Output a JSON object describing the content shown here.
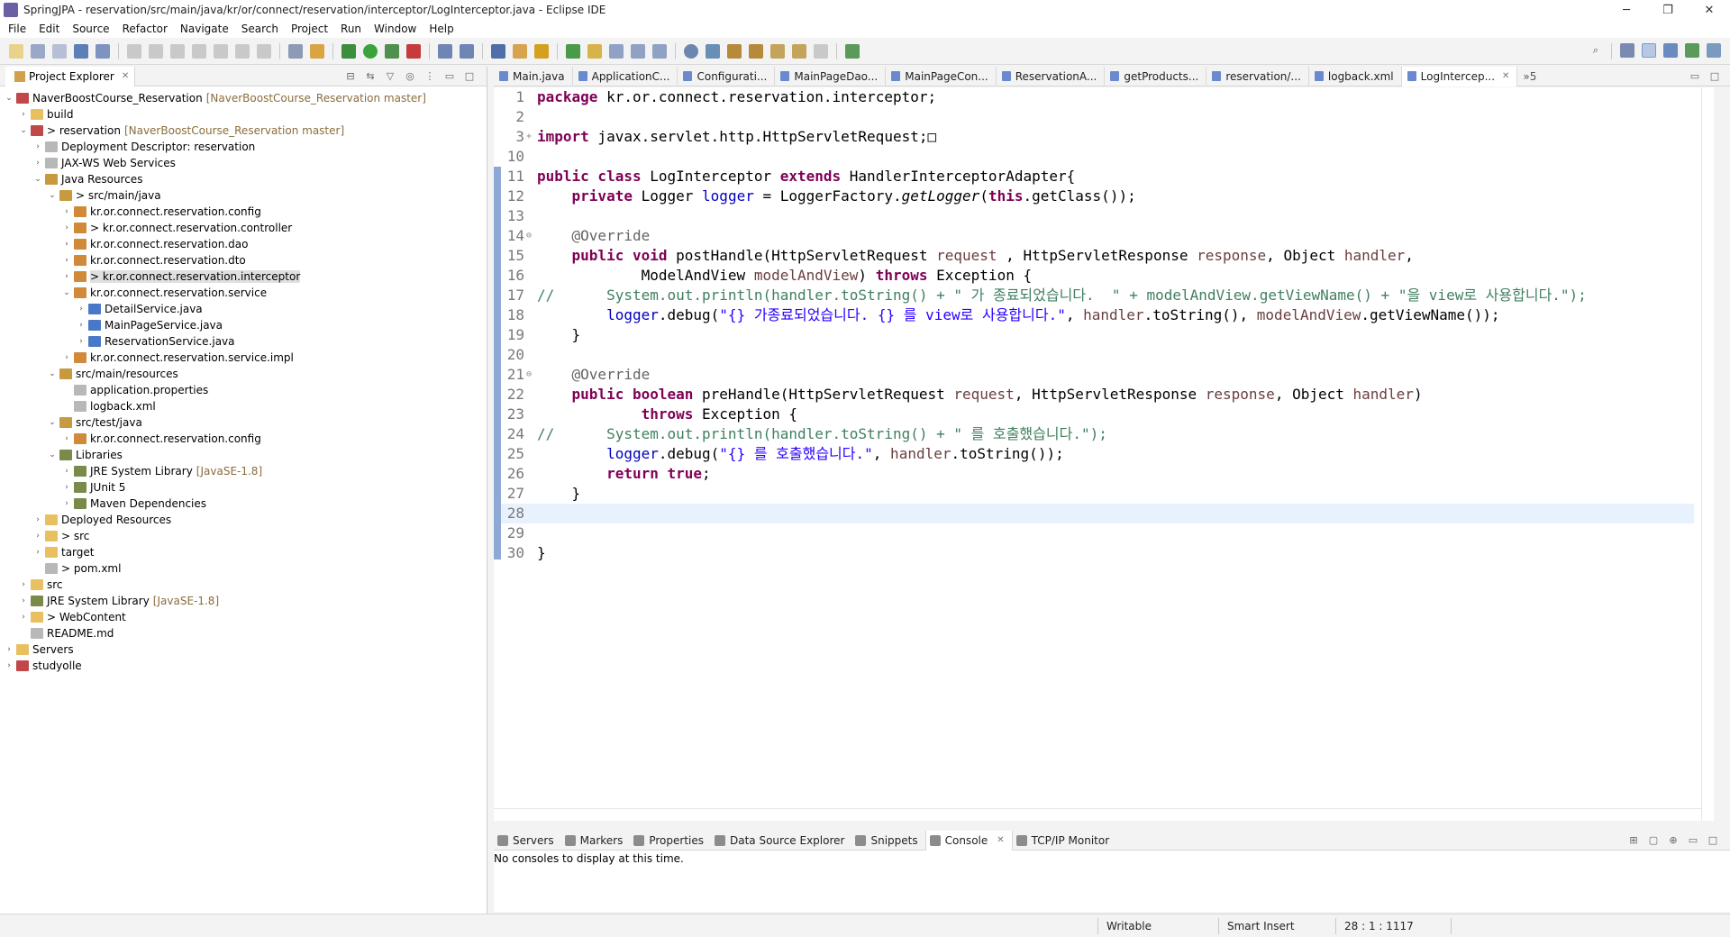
{
  "window": {
    "title": "SpringJPA - reservation/src/main/java/kr/or/connect/reservation/interceptor/LogInterceptor.java - Eclipse IDE",
    "minimize": "─",
    "maximize": "❐",
    "close": "✕"
  },
  "menu": [
    "File",
    "Edit",
    "Source",
    "Refactor",
    "Navigate",
    "Search",
    "Project",
    "Run",
    "Window",
    "Help"
  ],
  "explorer": {
    "title": "Project Explorer",
    "close": "✕",
    "tree": [
      {
        "label": "NaverBoostCourse_Reservation",
        "deco": "[NaverBoostCourse_Reservation master]",
        "indent": 0,
        "arrow": "v",
        "icon": "proj"
      },
      {
        "label": "build",
        "deco": "",
        "indent": 1,
        "arrow": ">",
        "icon": "folder"
      },
      {
        "label": "> reservation",
        "deco": "[NaverBoostCourse_Reservation master]",
        "indent": 1,
        "arrow": "v",
        "icon": "proj"
      },
      {
        "label": "Deployment Descriptor: reservation",
        "deco": "",
        "indent": 2,
        "arrow": ">",
        "icon": "file"
      },
      {
        "label": "JAX-WS Web Services",
        "deco": "",
        "indent": 2,
        "arrow": ">",
        "icon": "file"
      },
      {
        "label": "Java Resources",
        "deco": "",
        "indent": 2,
        "arrow": "v",
        "icon": "srcf"
      },
      {
        "label": "> src/main/java",
        "deco": "",
        "indent": 3,
        "arrow": "v",
        "icon": "srcf"
      },
      {
        "label": "kr.or.connect.reservation.config",
        "deco": "",
        "indent": 4,
        "arrow": ">",
        "icon": "pkg"
      },
      {
        "label": "> kr.or.connect.reservation.controller",
        "deco": "",
        "indent": 4,
        "arrow": ">",
        "icon": "pkg"
      },
      {
        "label": "kr.or.connect.reservation.dao",
        "deco": "",
        "indent": 4,
        "arrow": ">",
        "icon": "pkg"
      },
      {
        "label": "kr.or.connect.reservation.dto",
        "deco": "",
        "indent": 4,
        "arrow": ">",
        "icon": "pkg"
      },
      {
        "label": "> kr.or.connect.reservation.interceptor",
        "deco": "",
        "indent": 4,
        "arrow": ">",
        "icon": "pkg",
        "selected": true
      },
      {
        "label": "kr.or.connect.reservation.service",
        "deco": "",
        "indent": 4,
        "arrow": "v",
        "icon": "pkg"
      },
      {
        "label": "DetailService.java",
        "deco": "",
        "indent": 5,
        "arrow": ">",
        "icon": "java"
      },
      {
        "label": "MainPageService.java",
        "deco": "",
        "indent": 5,
        "arrow": ">",
        "icon": "java"
      },
      {
        "label": "ReservationService.java",
        "deco": "",
        "indent": 5,
        "arrow": ">",
        "icon": "java"
      },
      {
        "label": "kr.or.connect.reservation.service.impl",
        "deco": "",
        "indent": 4,
        "arrow": ">",
        "icon": "pkg"
      },
      {
        "label": "src/main/resources",
        "deco": "",
        "indent": 3,
        "arrow": "v",
        "icon": "srcf"
      },
      {
        "label": "application.properties",
        "deco": "",
        "indent": 4,
        "arrow": "",
        "icon": "file"
      },
      {
        "label": "logback.xml",
        "deco": "",
        "indent": 4,
        "arrow": "",
        "icon": "file"
      },
      {
        "label": "src/test/java",
        "deco": "",
        "indent": 3,
        "arrow": "v",
        "icon": "srcf"
      },
      {
        "label": "kr.or.connect.reservation.config",
        "deco": "",
        "indent": 4,
        "arrow": ">",
        "icon": "pkg"
      },
      {
        "label": "Libraries",
        "deco": "",
        "indent": 3,
        "arrow": "v",
        "icon": "lib"
      },
      {
        "label": "JRE System Library",
        "deco": "[JavaSE-1.8]",
        "indent": 4,
        "arrow": ">",
        "icon": "lib"
      },
      {
        "label": "JUnit 5",
        "deco": "",
        "indent": 4,
        "arrow": ">",
        "icon": "lib"
      },
      {
        "label": "Maven Dependencies",
        "deco": "",
        "indent": 4,
        "arrow": ">",
        "icon": "lib"
      },
      {
        "label": "Deployed Resources",
        "deco": "",
        "indent": 2,
        "arrow": ">",
        "icon": "folder"
      },
      {
        "label": "> src",
        "deco": "",
        "indent": 2,
        "arrow": ">",
        "icon": "folder"
      },
      {
        "label": "target",
        "deco": "",
        "indent": 2,
        "arrow": ">",
        "icon": "folder"
      },
      {
        "label": "> pom.xml",
        "deco": "",
        "indent": 2,
        "arrow": "",
        "icon": "file"
      },
      {
        "label": "src",
        "deco": "",
        "indent": 1,
        "arrow": ">",
        "icon": "folder"
      },
      {
        "label": "JRE System Library",
        "deco": "[JavaSE-1.8]",
        "indent": 1,
        "arrow": ">",
        "icon": "lib"
      },
      {
        "label": "> WebContent",
        "deco": "",
        "indent": 1,
        "arrow": ">",
        "icon": "folder"
      },
      {
        "label": "README.md",
        "deco": "",
        "indent": 1,
        "arrow": "",
        "icon": "file"
      },
      {
        "label": "Servers",
        "deco": "",
        "indent": 0,
        "arrow": ">",
        "icon": "folder"
      },
      {
        "label": "studyolle",
        "deco": "",
        "indent": 0,
        "arrow": ">",
        "icon": "proj"
      }
    ]
  },
  "editor_tabs": [
    {
      "label": "Main.java",
      "active": false
    },
    {
      "label": "ApplicationC...",
      "active": false
    },
    {
      "label": "Configurati...",
      "active": false
    },
    {
      "label": "MainPageDao...",
      "active": false
    },
    {
      "label": "MainPageCon...",
      "active": false
    },
    {
      "label": "ReservationA...",
      "active": false
    },
    {
      "label": "getProducts...",
      "active": false
    },
    {
      "label": "reservation/...",
      "active": false
    },
    {
      "label": "logback.xml",
      "active": false
    },
    {
      "label": "LogIntercep...",
      "active": true
    }
  ],
  "editor_overflow": "»5",
  "code_lines": [
    {
      "n": "1",
      "fold": "",
      "tokens": [
        [
          "kw",
          "package"
        ],
        [
          "",
          "kr.or.connect.reservation.interceptor;"
        ]
      ]
    },
    {
      "n": "2",
      "fold": "",
      "tokens": []
    },
    {
      "n": "3",
      "fold": "+",
      "tokens": [
        [
          "kw",
          "import"
        ],
        [
          "",
          "javax.servlet.http.HttpServletRequest;□"
        ]
      ]
    },
    {
      "n": "10",
      "fold": "",
      "tokens": []
    },
    {
      "n": "11",
      "fold": "",
      "tokens": [
        [
          "kw",
          "public"
        ],
        [
          "kw",
          "class"
        ],
        [
          "",
          "LogInterceptor"
        ],
        [
          "kw",
          "extends"
        ],
        [
          "",
          "HandlerInterceptorAdapter{"
        ]
      ]
    },
    {
      "n": "12",
      "fold": "",
      "tokens": [
        [
          "",
          "    "
        ],
        [
          "kw",
          "private"
        ],
        [
          "",
          "Logger"
        ],
        [
          "fld",
          "logger"
        ],
        [
          "",
          "= LoggerFactory."
        ],
        [
          "itl",
          "getLogger"
        ],
        [
          "",
          "("
        ],
        [
          "kw",
          "this"
        ],
        [
          "",
          ".getClass());"
        ]
      ]
    },
    {
      "n": "13",
      "fold": "",
      "tokens": []
    },
    {
      "n": "14",
      "fold": "⊖",
      "tokens": [
        [
          "",
          "    "
        ],
        [
          "ann",
          "@Override"
        ]
      ]
    },
    {
      "n": "15",
      "fold": "",
      "tokens": [
        [
          "",
          "    "
        ],
        [
          "kw",
          "public"
        ],
        [
          "kw",
          "void"
        ],
        [
          "",
          "postHandle(HttpServletRequest"
        ],
        [
          "par",
          "request"
        ],
        [
          "",
          " , HttpServletResponse"
        ],
        [
          "par",
          "response"
        ],
        [
          "",
          ", Object"
        ],
        [
          "par",
          "handler"
        ],
        [
          "",
          ","
        ]
      ]
    },
    {
      "n": "16",
      "fold": "",
      "tokens": [
        [
          "",
          "            ModelAndView"
        ],
        [
          "par",
          "modelAndView"
        ],
        [
          "",
          ")"
        ],
        [
          "kw",
          "throws"
        ],
        [
          "",
          "Exception {"
        ]
      ]
    },
    {
      "n": "17",
      "fold": "",
      "tokens": [
        [
          "cmt",
          "//      System.out.println(handler.toString() + \" 가 종료되었습니다.  \" + modelAndView.getViewName() + \"을 view로 사용합니다.\");"
        ]
      ]
    },
    {
      "n": "18",
      "fold": "",
      "tokens": [
        [
          "",
          "        "
        ],
        [
          "fld",
          "logger"
        ],
        [
          "",
          ".debug("
        ],
        [
          "str",
          "\"{} 가종료되었습니다. {} 를 view로 사용합니다.\""
        ],
        [
          "",
          ","
        ],
        [
          "par",
          "handler"
        ],
        [
          "",
          ".toString(),"
        ],
        [
          "par",
          "modelAndView"
        ],
        [
          "",
          ".getViewName());"
        ]
      ]
    },
    {
      "n": "19",
      "fold": "",
      "tokens": [
        [
          "",
          "    }"
        ]
      ]
    },
    {
      "n": "20",
      "fold": "",
      "tokens": []
    },
    {
      "n": "21",
      "fold": "⊖",
      "tokens": [
        [
          "",
          "    "
        ],
        [
          "ann",
          "@Override"
        ]
      ]
    },
    {
      "n": "22",
      "fold": "",
      "tokens": [
        [
          "",
          "    "
        ],
        [
          "kw",
          "public"
        ],
        [
          "kw",
          "boolean"
        ],
        [
          "",
          "preHandle(HttpServletRequest"
        ],
        [
          "par",
          "request"
        ],
        [
          "",
          ", HttpServletResponse"
        ],
        [
          "par",
          "response"
        ],
        [
          "",
          ", Object"
        ],
        [
          "par",
          "handler"
        ],
        [
          "",
          ")"
        ]
      ]
    },
    {
      "n": "23",
      "fold": "",
      "tokens": [
        [
          "",
          "            "
        ],
        [
          "kw",
          "throws"
        ],
        [
          "",
          "Exception {"
        ]
      ]
    },
    {
      "n": "24",
      "fold": "",
      "tokens": [
        [
          "cmt",
          "//      System.out.println(handler.toString() + \" 를 호출했습니다.\");"
        ]
      ]
    },
    {
      "n": "25",
      "fold": "",
      "tokens": [
        [
          "",
          "        "
        ],
        [
          "fld",
          "logger"
        ],
        [
          "",
          ".debug("
        ],
        [
          "str",
          "\"{} 를 호출했습니다.\""
        ],
        [
          "",
          ","
        ],
        [
          "par",
          "handler"
        ],
        [
          "",
          ".toString());"
        ]
      ]
    },
    {
      "n": "26",
      "fold": "",
      "tokens": [
        [
          "",
          "        "
        ],
        [
          "kw",
          "return"
        ],
        [
          "kw",
          "true"
        ],
        [
          "",
          ";"
        ]
      ]
    },
    {
      "n": "27",
      "fold": "",
      "tokens": [
        [
          "",
          "    }"
        ]
      ]
    },
    {
      "n": "28",
      "fold": "",
      "tokens": [],
      "current": true
    },
    {
      "n": "29",
      "fold": "",
      "tokens": []
    },
    {
      "n": "30",
      "fold": "",
      "tokens": [
        [
          "",
          "}"
        ]
      ]
    }
  ],
  "console": {
    "tabs": [
      {
        "label": "Servers",
        "active": false
      },
      {
        "label": "Markers",
        "active": false
      },
      {
        "label": "Properties",
        "active": false
      },
      {
        "label": "Data Source Explorer",
        "active": false
      },
      {
        "label": "Snippets",
        "active": false
      },
      {
        "label": "Console",
        "active": true
      },
      {
        "label": "TCP/IP Monitor",
        "active": false
      }
    ],
    "close": "✕",
    "message": "No consoles to display at this time."
  },
  "status": {
    "mode": "Writable",
    "insert": "Smart Insert",
    "position": "28 : 1 : 1117"
  }
}
